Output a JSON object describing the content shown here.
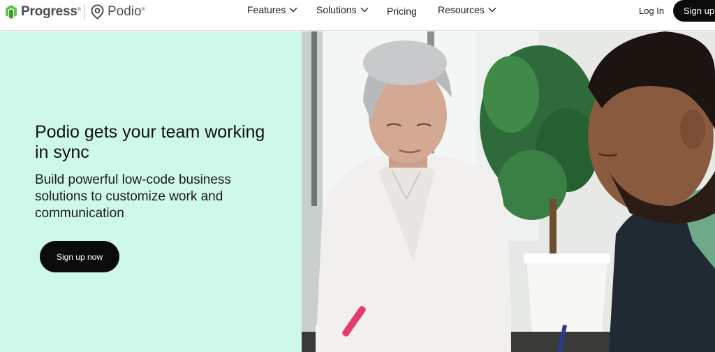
{
  "header": {
    "brand_progress": "Progress",
    "brand_podio": "Podio",
    "registered_mark": "®",
    "nav": [
      {
        "label": "Features",
        "has_dropdown": true
      },
      {
        "label": "Solutions",
        "has_dropdown": true
      },
      {
        "label": "Pricing",
        "has_dropdown": false
      },
      {
        "label": "Resources",
        "has_dropdown": true
      }
    ],
    "login_label": "Log In",
    "signup_label": "Sign up"
  },
  "hero": {
    "title": "Podio gets your team working in sync",
    "subtitle": "Build powerful low-code business solutions to customize work and communication",
    "cta_label": "Sign up now",
    "background_color": "#cdf8ea"
  },
  "colors": {
    "accent_green": "#5ec24a",
    "button_black": "#0b0b0b",
    "logo_gray": "#4a4f55"
  },
  "icons": {
    "progress_logo": "progress-logo-icon",
    "podio_logo": "podio-pin-icon",
    "dropdown": "chevron-down-icon"
  }
}
